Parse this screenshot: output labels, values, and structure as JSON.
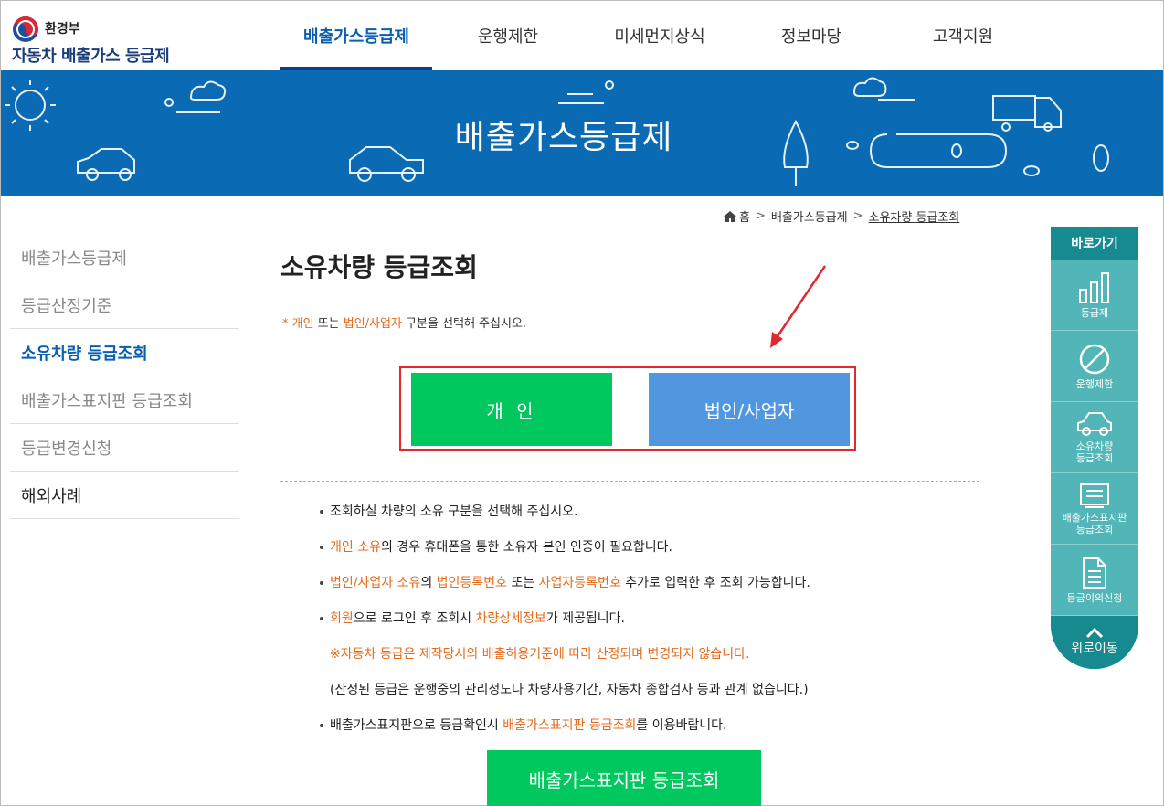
{
  "header": {
    "ministry": "환경부",
    "site_name": "자동차 배출가스 등급제",
    "nav": [
      "배출가스등급제",
      "운행제한",
      "미세먼지상식",
      "정보마당",
      "고객지원"
    ],
    "active_nav": "배출가스등급제"
  },
  "banner": {
    "title": "배출가스등급제"
  },
  "breadcrumb": {
    "home": "홈",
    "level1": "배출가스등급제",
    "current": "소유차량 등급조회"
  },
  "sidebar": {
    "items": [
      {
        "label": "배출가스등급제"
      },
      {
        "label": "등급산정기준"
      },
      {
        "label": "소유차량 등급조회"
      },
      {
        "label": "배출가스표지판 등급조회"
      },
      {
        "label": "등급변경신청"
      },
      {
        "label": "해외사례"
      }
    ],
    "active_item": "소유차량 등급조회"
  },
  "main": {
    "title": "소유차량 등급조회",
    "notice": {
      "mark": "*",
      "part1": "개인",
      "part2": " 또는 ",
      "part3": "법인/사업자",
      "part4": " 구분을 선택해 주십시오."
    },
    "choice": {
      "person_label": "개 인",
      "corp_label": "법인/사업자"
    },
    "guide": {
      "line1": "조회하실 차량의 소유 구분을 선택해 주십시오.",
      "line2_a": "개인 소유",
      "line2_b": "의 경우 휴대폰을 통한 소유자 본인 인증이 필요합니다.",
      "line3_a": "법인/사업자 소유",
      "line3_b": "의 ",
      "line3_c": "법인등록번호",
      "line3_d": " 또는 ",
      "line3_e": "사업자등록번호",
      "line3_f": " 추가로 입력한 후 조회 가능합니다.",
      "line4_a": "회원",
      "line4_b": "으로 로그인 후 조회시 ",
      "line4_c": "차량상세정보",
      "line4_d": "가 제공됩니다.",
      "line5": "※자동차 등급은 제작당시의 배출허용기준에 따라 산정되며 변경되지 않습니다.",
      "line6": "(산정된 등급은 운행중의 관리정도나 차량사용기간, 자동차 종합검사 등과 관계 없습니다.)",
      "line7_a": "배출가스표지판으로 등급확인시 ",
      "line7_b": "배출가스표지판 등급조회",
      "line7_c": "를 이용바랍니다."
    },
    "sign_button": "배출가스표지판 등급조회"
  },
  "quick_menu": {
    "head": "바로가기",
    "items": [
      {
        "label": "등급제",
        "icon": "bar-chart-icon"
      },
      {
        "label": "운행제한",
        "icon": "prohibited-icon"
      },
      {
        "label_1": "소유차량",
        "label_2": "등급조회",
        "icon": "car-icon"
      },
      {
        "label_1": "배출가스표지판",
        "label_2": "등급조회",
        "icon": "sign-board-icon"
      },
      {
        "label": "등급이의신청",
        "icon": "document-icon"
      }
    ],
    "top_label": "위로이동"
  },
  "colors": {
    "primary_blue": "#0a6bb4",
    "nav_active": "#0a5fb0",
    "orange_text": "#e46b1c",
    "green_button": "#00c75e",
    "blue_button": "#5097e0",
    "highlight_red": "#e4262f",
    "quick_teal": "#52b5b8"
  }
}
